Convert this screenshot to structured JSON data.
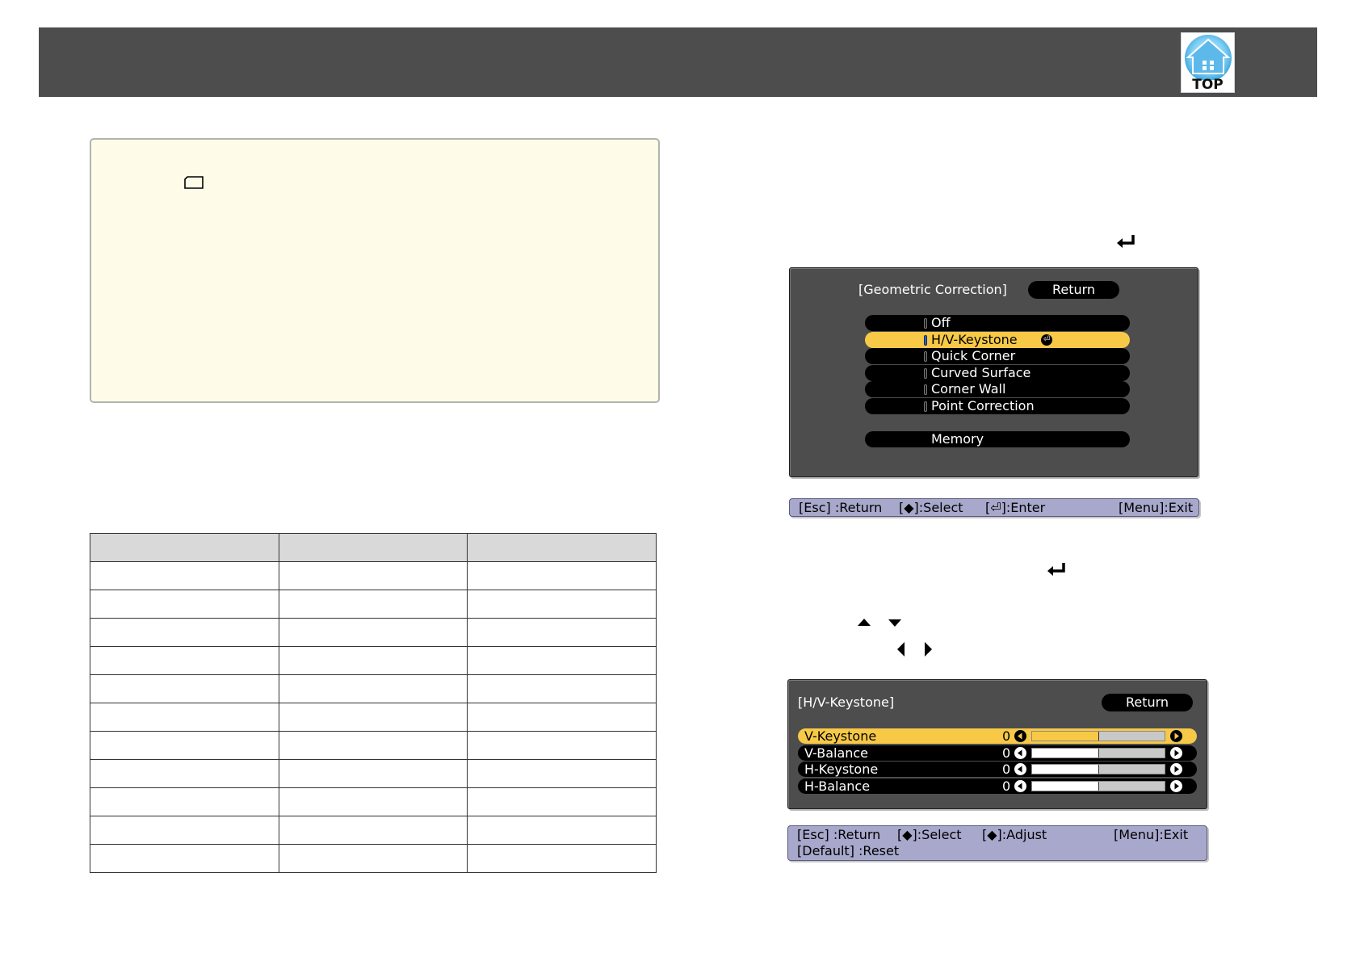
{
  "header": {
    "top_button_label": "TOP"
  },
  "note": {
    "icon": "note-icon"
  },
  "spec_table": {
    "columns": [
      "",
      "",
      ""
    ],
    "rows": [
      [
        "",
        "",
        ""
      ],
      [
        "",
        "",
        ""
      ],
      [
        "",
        "",
        ""
      ],
      [
        "",
        "",
        ""
      ],
      [
        "",
        "",
        ""
      ],
      [
        "",
        "",
        ""
      ],
      [
        "",
        "",
        ""
      ],
      [
        "",
        "",
        ""
      ],
      [
        "",
        "",
        ""
      ],
      [
        "",
        "",
        ""
      ],
      [
        "",
        "",
        ""
      ]
    ]
  },
  "geometric_menu": {
    "title": "[Geometric Correction]",
    "return_label": "Return",
    "items": [
      {
        "label": "Off",
        "selected": false
      },
      {
        "label": "H/V-Keystone",
        "selected": true
      },
      {
        "label": "Quick Corner",
        "selected": false
      },
      {
        "label": "Curved Surface",
        "selected": false
      },
      {
        "label": "Corner Wall",
        "selected": false
      },
      {
        "label": "Point Correction",
        "selected": false
      }
    ],
    "memory_label": "Memory",
    "help": {
      "esc": "[Esc] :Return",
      "select": "[◆]:Select",
      "enter": "[⏎]:Enter",
      "exit": "[Menu]:Exit"
    }
  },
  "hv_keystone_menu": {
    "title": "[H/V-Keystone]",
    "return_label": "Return",
    "items": [
      {
        "name": "V-Keystone",
        "value": "0",
        "level": 0.5,
        "selected": true
      },
      {
        "name": "V-Balance",
        "value": "0",
        "level": 0.5,
        "selected": false
      },
      {
        "name": "H-Keystone",
        "value": "0",
        "level": 0.5,
        "selected": false
      },
      {
        "name": "H-Balance",
        "value": "0",
        "level": 0.5,
        "selected": false
      }
    ],
    "help": {
      "esc": "[Esc] :Return",
      "select": "[◆]:Select",
      "adjust": "[◆]:Adjust",
      "exit": "[Menu]:Exit",
      "default": "[Default] :Reset"
    }
  },
  "colors": {
    "highlight": "#f7c947",
    "helpbar": "#a8a8cc",
    "header": "#4d4d4d",
    "note_bg": "#fefbe8"
  }
}
